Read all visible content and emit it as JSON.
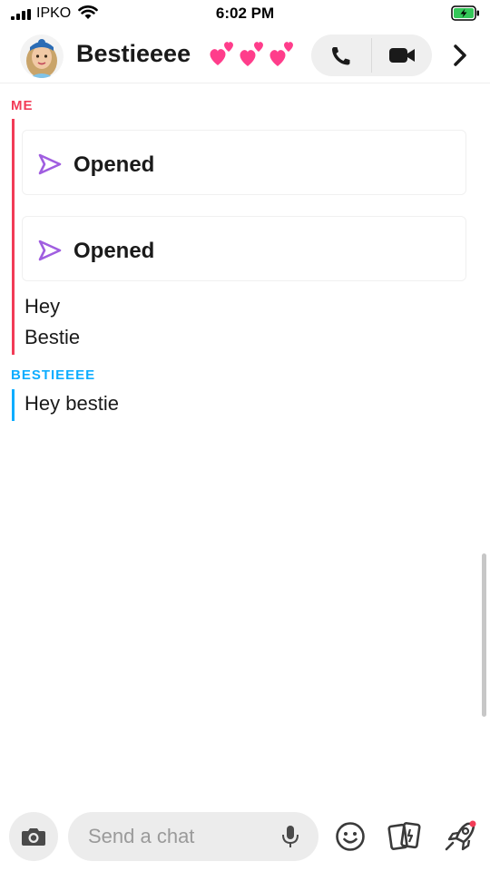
{
  "status_bar": {
    "carrier": "IPKO",
    "time": "6:02 PM"
  },
  "header": {
    "name": "Bestieeee",
    "icons": {
      "hearts": "two-hearts-icon",
      "call": "phone-icon",
      "video": "video-camera-icon",
      "more": "chevron-right-icon"
    }
  },
  "messages": {
    "me_label": "ME",
    "snaps": [
      {
        "status": "Opened"
      },
      {
        "status": "Opened"
      }
    ],
    "me_texts": [
      "Hey",
      "Bestie"
    ],
    "friend_label": "BESTIEEEE",
    "friend_texts": [
      "Hey bestie"
    ]
  },
  "input": {
    "placeholder": "Send a chat"
  },
  "colors": {
    "me": "#f23c57",
    "friend": "#0eadff",
    "snap_arrow": "#a05ee0",
    "pill_bg": "#ececec"
  }
}
